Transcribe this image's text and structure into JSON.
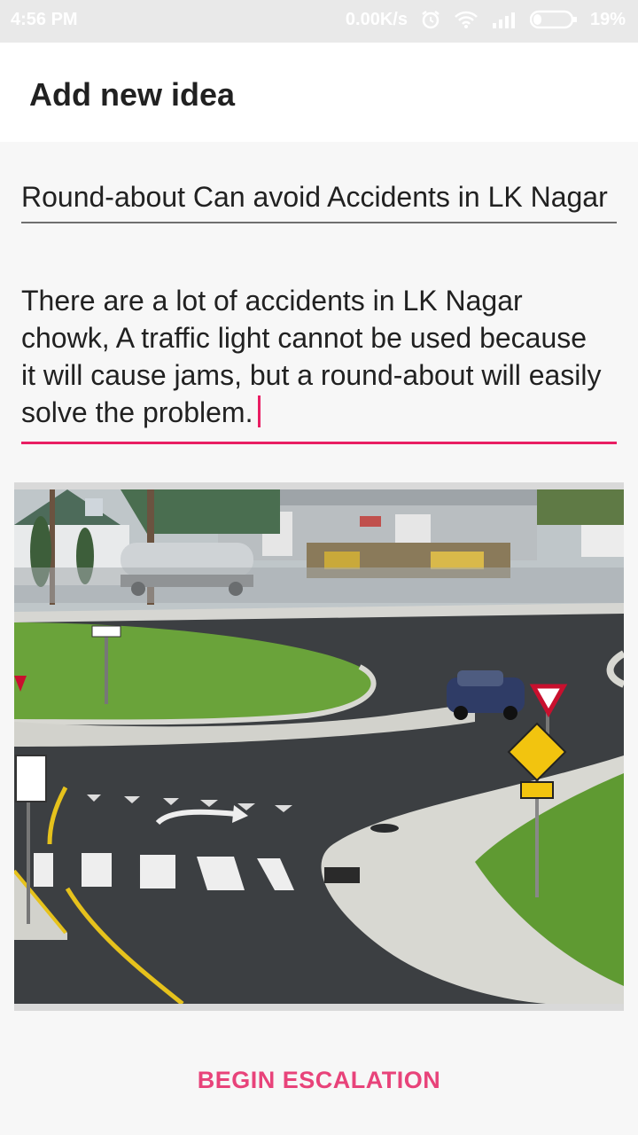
{
  "status_bar": {
    "time": "4:56 PM",
    "network_speed": "0.00K/s",
    "battery": "19%"
  },
  "app_bar": {
    "title": "Add new idea"
  },
  "form": {
    "title_value": "Round-about Can avoid Accidents in LK Nagar",
    "description_value": "There are a lot of accidents in LK Nagar chowk, A traffic light cannot be used because it will cause jams, but a round-about will easily solve the problem.",
    "image_alt": "Photo of a roundabout intersection with crosswalks and signs"
  },
  "actions": {
    "begin_escalation": "BEGIN ESCALATION"
  },
  "colors": {
    "accent": "#e91e63",
    "button_text": "#e8437a"
  }
}
